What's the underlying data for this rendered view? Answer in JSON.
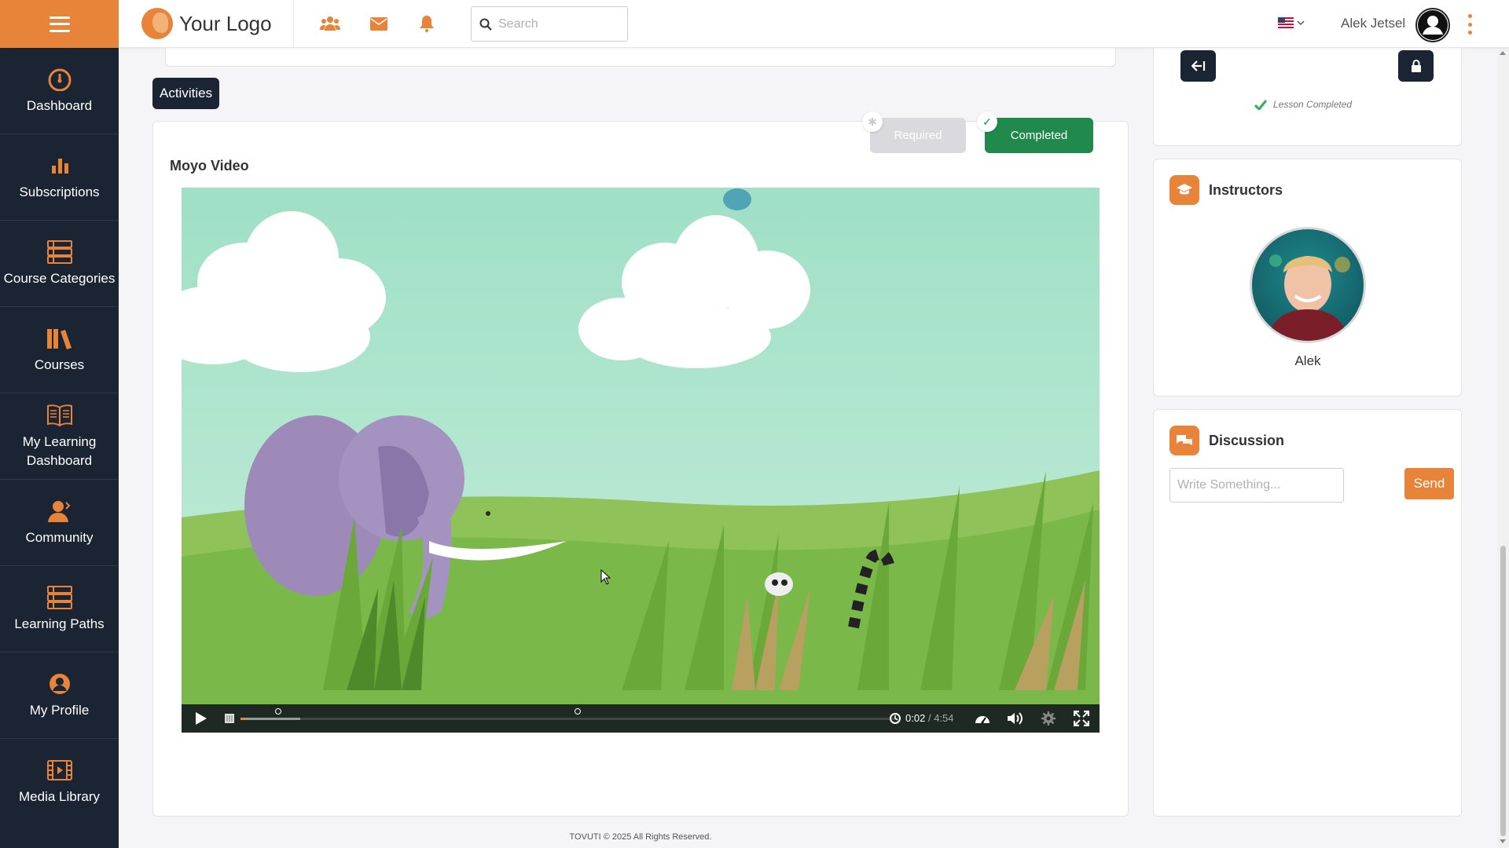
{
  "header": {
    "logo_text": "Your Logo",
    "search_placeholder": "Search",
    "user_name": "Alek Jetsel",
    "icons": [
      "users-icon",
      "mail-icon",
      "bell-icon",
      "search-icon",
      "flag-us-icon",
      "user-avatar-icon",
      "more-vertical-icon"
    ]
  },
  "sidebar": {
    "items": [
      {
        "label": "Dashboard",
        "icon": "dashboard-gauge-icon"
      },
      {
        "label": "Subscriptions",
        "icon": "bar-chart-icon"
      },
      {
        "label": "Course Categories",
        "icon": "list-icon"
      },
      {
        "label": "Courses",
        "icon": "books-icon"
      },
      {
        "label": "My Learning Dashboard",
        "icon": "open-book-icon"
      },
      {
        "label": "Community",
        "icon": "community-icon"
      },
      {
        "label": "Learning Paths",
        "icon": "list-icon"
      },
      {
        "label": "My Profile",
        "icon": "user-circle-icon"
      },
      {
        "label": "Media Library",
        "icon": "film-icon"
      }
    ]
  },
  "main": {
    "activities_label": "Activities",
    "required_label": "Required",
    "completed_label": "Completed",
    "video_title": "Moyo Video",
    "player": {
      "current_time": "0:02",
      "separator": "/",
      "duration": "4:54",
      "progress_fraction": 0.007,
      "buffered_fraction": 0.09
    }
  },
  "right": {
    "lesson_completed": "Lesson Completed",
    "instructors_title": "Instructors",
    "instructor_name": "Alek",
    "discussion_title": "Discussion",
    "discussion_placeholder": "Write Something...",
    "send_label": "Send"
  },
  "footer": {
    "copyright": "TOVUTI © 2025 All Rights Reserved."
  },
  "colors": {
    "accent": "#e8833a",
    "sidebar_bg": "#1b2432",
    "completed_green": "#1f8a4c",
    "required_gray": "#d9d9de"
  }
}
